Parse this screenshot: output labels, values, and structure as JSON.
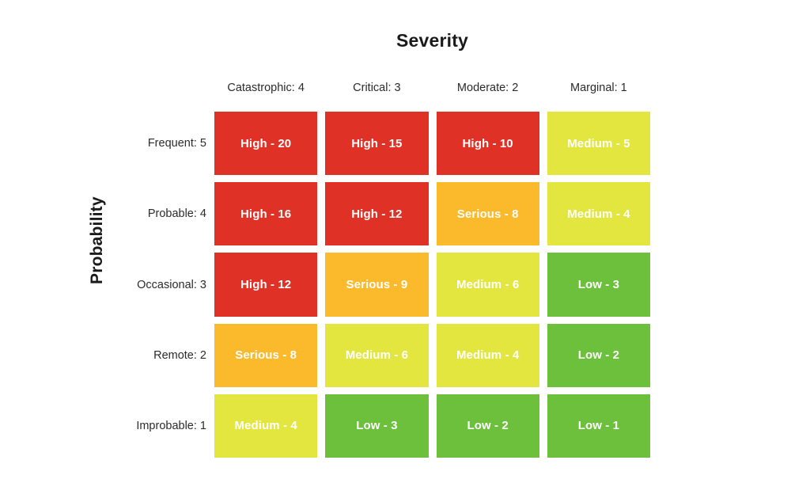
{
  "chart_data": {
    "type": "heatmap",
    "title": "Severity",
    "xlabel": "Severity",
    "ylabel": "Probability",
    "grid": false,
    "legend": "none",
    "categories": [
      "Catastrophic: 4",
      "Critical: 3",
      "Moderate: 2",
      "Marginal: 1"
    ],
    "x_values": [
      4,
      3,
      2,
      1
    ],
    "rows": [
      "Frequent: 5",
      "Probable: 4",
      "Occasional: 3",
      "Remote: 2",
      "Improbable: 1"
    ],
    "y_values": [
      5,
      4,
      3,
      2,
      1
    ],
    "values": [
      [
        20,
        15,
        10,
        5
      ],
      [
        16,
        12,
        8,
        4
      ],
      [
        12,
        9,
        6,
        3
      ],
      [
        8,
        6,
        4,
        2
      ],
      [
        4,
        3,
        2,
        1
      ]
    ],
    "levels": [
      [
        "High",
        "High",
        "High",
        "Medium"
      ],
      [
        "High",
        "High",
        "Serious",
        "Medium"
      ],
      [
        "High",
        "Serious",
        "Medium",
        "Low"
      ],
      [
        "Serious",
        "Medium",
        "Medium",
        "Low"
      ],
      [
        "Medium",
        "Low",
        "Low",
        "Low"
      ]
    ],
    "cell_labels": [
      [
        "High - 20",
        "High - 15",
        "High - 10",
        "Medium - 5"
      ],
      [
        "High - 16",
        "High - 12",
        "Serious - 8",
        "Medium - 4"
      ],
      [
        "High - 12",
        "Serious - 9",
        "Medium - 6",
        "Low - 3"
      ],
      [
        "Serious - 8",
        "Medium - 6",
        "Medium - 4",
        "Low - 2"
      ],
      [
        "Medium - 4",
        "Low - 3",
        "Low - 2",
        "Low - 1"
      ]
    ],
    "level_colors": {
      "High": "#e03127",
      "Serious": "#fbb92c",
      "Medium": "#e3e63f",
      "Low": "#6cc03c"
    },
    "background_color": "#ffffff",
    "cell_text_color": "#ffffff"
  },
  "axes": {
    "x_title": "Severity",
    "y_title": "Probability",
    "column_headers": [
      "Catastrophic: 4",
      "Critical: 3",
      "Moderate: 2",
      "Marginal: 1"
    ],
    "row_headers": [
      "Frequent: 5",
      "Probable: 4",
      "Occasional: 3",
      "Remote: 2",
      "Improbable: 1"
    ]
  },
  "cells": {
    "r0": [
      "High - 20",
      "High - 15",
      "High - 10",
      "Medium - 5"
    ],
    "r1": [
      "High - 16",
      "High - 12",
      "Serious - 8",
      "Medium - 4"
    ],
    "r2": [
      "High - 12",
      "Serious - 9",
      "Medium - 6",
      "Low - 3"
    ],
    "r3": [
      "Serious - 8",
      "Medium - 6",
      "Medium - 4",
      "Low - 2"
    ],
    "r4": [
      "Medium - 4",
      "Low - 3",
      "Low - 2",
      "Low - 1"
    ]
  }
}
